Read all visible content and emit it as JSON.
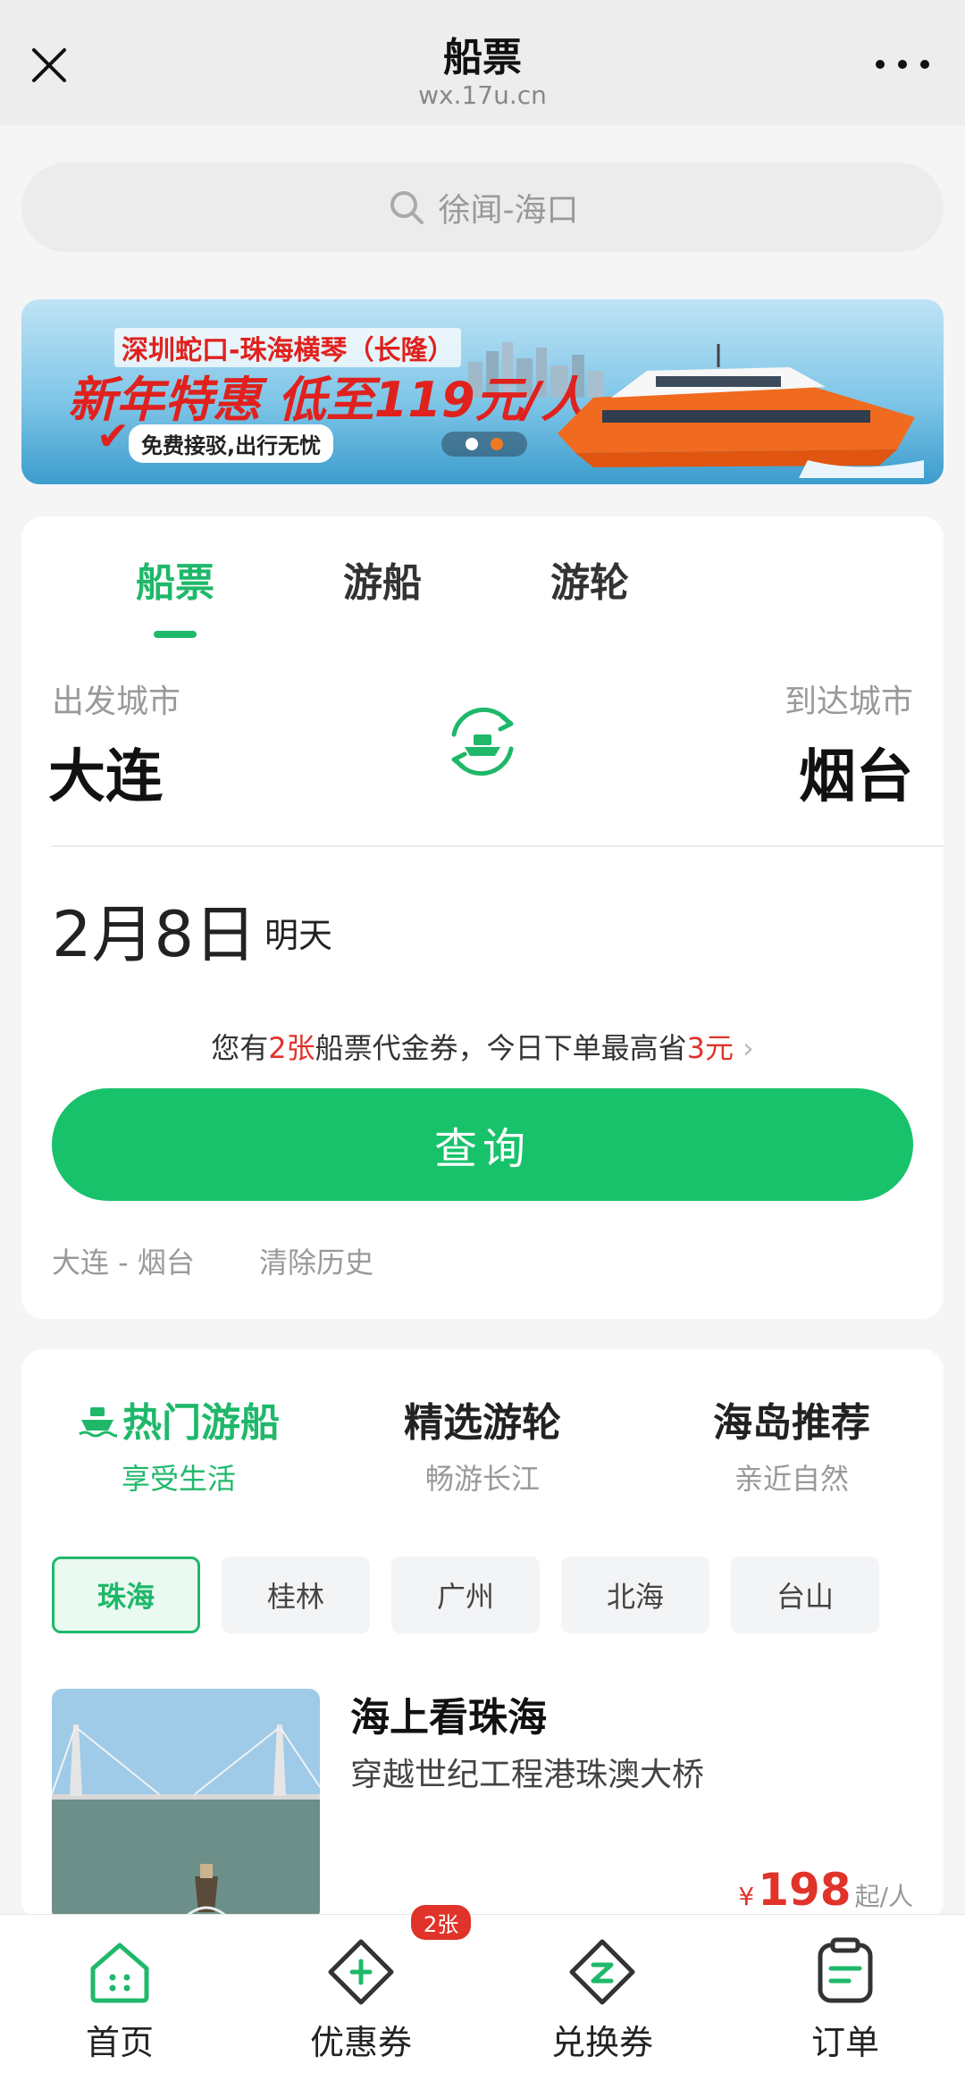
{
  "header": {
    "title": "船票",
    "url": "wx.17u.cn"
  },
  "search": {
    "placeholder": "徐闻-海口"
  },
  "banner": {
    "line1": "深圳蛇口-珠海横琴（长隆）",
    "line2": "新年特惠 低至119元/人",
    "line3": "免费接驳,出行无忧",
    "dot_active_color": "#f07a22"
  },
  "booking": {
    "tabs": [
      {
        "label": "船票",
        "active": true
      },
      {
        "label": "游船",
        "active": false
      },
      {
        "label": "游轮",
        "active": false
      }
    ],
    "departure_label": "出发城市",
    "departure_city": "大连",
    "arrival_label": "到达城市",
    "arrival_city": "烟台",
    "date": "2月8日",
    "date_sub": "明天",
    "voucher": {
      "prefix": "您有",
      "count": "2张",
      "middle": "船票代金券，今日下单最高省",
      "amount": "3元",
      "chevron": "›"
    },
    "query_button": "查询",
    "history_route": "大连 - 烟台",
    "clear_history": "清除历史"
  },
  "recommend": {
    "categories": [
      {
        "title": "热门游船",
        "subtitle": "享受生活",
        "active": true
      },
      {
        "title": "精选游轮",
        "subtitle": "畅游长江",
        "active": false
      },
      {
        "title": "海岛推荐",
        "subtitle": "亲近自然",
        "active": false
      }
    ],
    "cities": [
      "珠海",
      "桂林",
      "广州",
      "北海",
      "台山"
    ],
    "active_city": "珠海",
    "item": {
      "title": "海上看珠海",
      "desc": "穿越世纪工程港珠澳大桥",
      "currency": "¥",
      "price": "198",
      "unit": "起/人"
    }
  },
  "bottom_nav": {
    "items": [
      {
        "label": "首页",
        "icon": "home-icon",
        "active": true
      },
      {
        "label": "优惠券",
        "icon": "coupon-icon",
        "active": false
      },
      {
        "label": "兑换券",
        "icon": "exchange-ticket-icon",
        "active": false
      },
      {
        "label": "订单",
        "icon": "order-icon",
        "active": false
      }
    ],
    "coupon_badge": "2张"
  },
  "colors": {
    "accent": "#17c26b",
    "price": "#e0332a"
  }
}
